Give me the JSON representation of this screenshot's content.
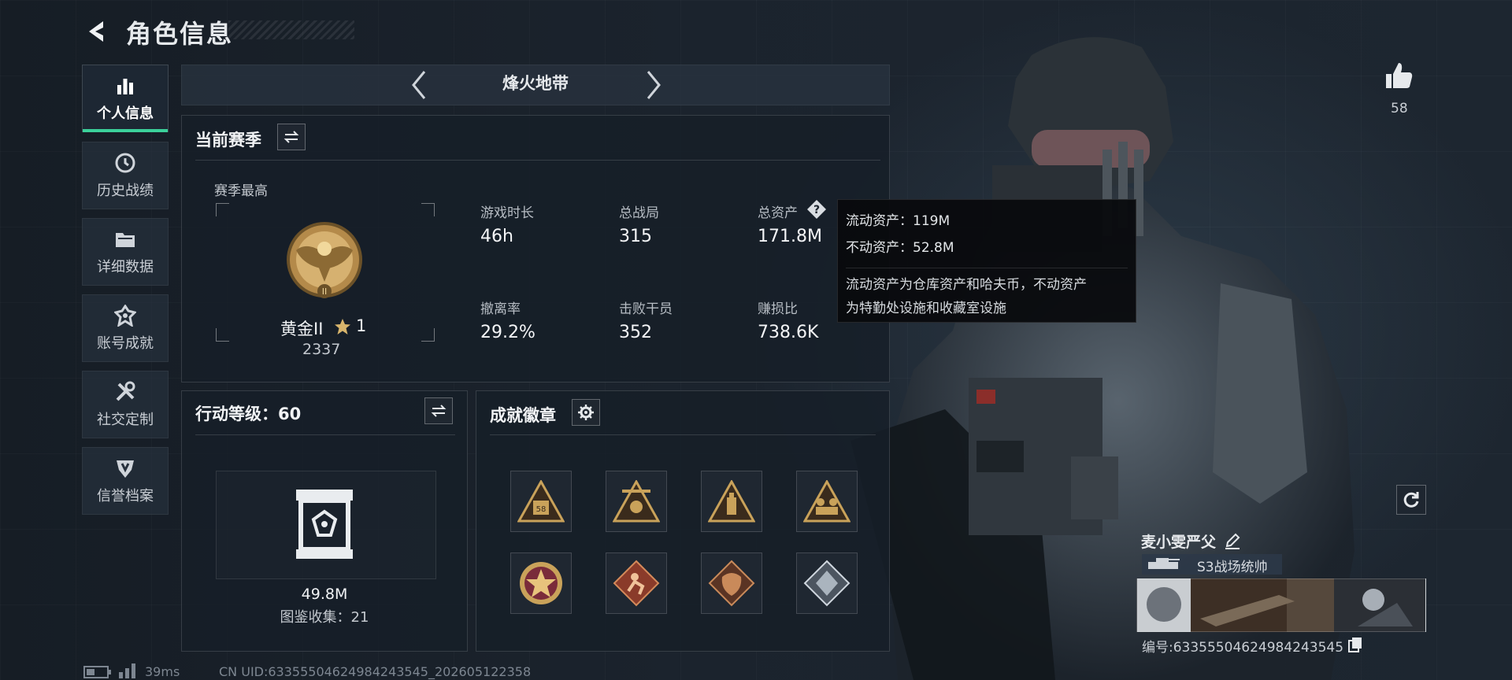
{
  "header": {
    "title": "角色信息"
  },
  "nav": [
    {
      "label": "个人信息",
      "icon": "bar-chart-icon",
      "active": true
    },
    {
      "label": "历史战绩",
      "icon": "clock-icon"
    },
    {
      "label": "详细数据",
      "icon": "folder-icon"
    },
    {
      "label": "账号成就",
      "icon": "achievement-icon"
    },
    {
      "label": "社交定制",
      "icon": "tools-icon"
    },
    {
      "label": "信誉档案",
      "icon": "shield-icon"
    }
  ],
  "mode": {
    "title": "烽火地带"
  },
  "season": {
    "title": "当前赛季",
    "best_label": "赛季最高",
    "rank_name": "黄金II",
    "rank_stars": "1",
    "rank_score": "2337",
    "stats": [
      {
        "label": "游戏时长",
        "value": "46h"
      },
      {
        "label": "总战局",
        "value": "315"
      },
      {
        "label": "总资产",
        "value": "171.8M"
      },
      {
        "label": "撤离率",
        "value": "29.2%"
      },
      {
        "label": "击败干员",
        "value": "352"
      },
      {
        "label": "赚损比",
        "value": "738.6K"
      }
    ]
  },
  "tooltip": {
    "liquid": "流动资产：119M",
    "fixed": "不动资产：52.8M",
    "desc_line1": "流动资产为仓库资产和哈夫币，不动资产",
    "desc_line2": "为特勤处设施和收藏室设施"
  },
  "level": {
    "title": "行动等级：60",
    "value": "49.8M",
    "collection": "图鉴收集：21"
  },
  "badges": {
    "title": "成就徽章",
    "items": [
      "badge-triangle-58",
      "badge-triangle-wreath",
      "badge-triangle-bottle",
      "badge-triangle-squad",
      "badge-round-star",
      "badge-diamond-runner",
      "badge-diamond-beast",
      "badge-diamond-silver"
    ]
  },
  "likes": {
    "count": "58"
  },
  "player": {
    "name": "麦小雯严父",
    "title": "S3战场统帅",
    "id": "编号:6335550462498424354‌5"
  },
  "footer": {
    "ping": "39ms",
    "uid": "CN UID:633555046249842435‌45_202605122358"
  },
  "colors": {
    "accent": "#3bd19a",
    "gold": "#c9a25a"
  }
}
